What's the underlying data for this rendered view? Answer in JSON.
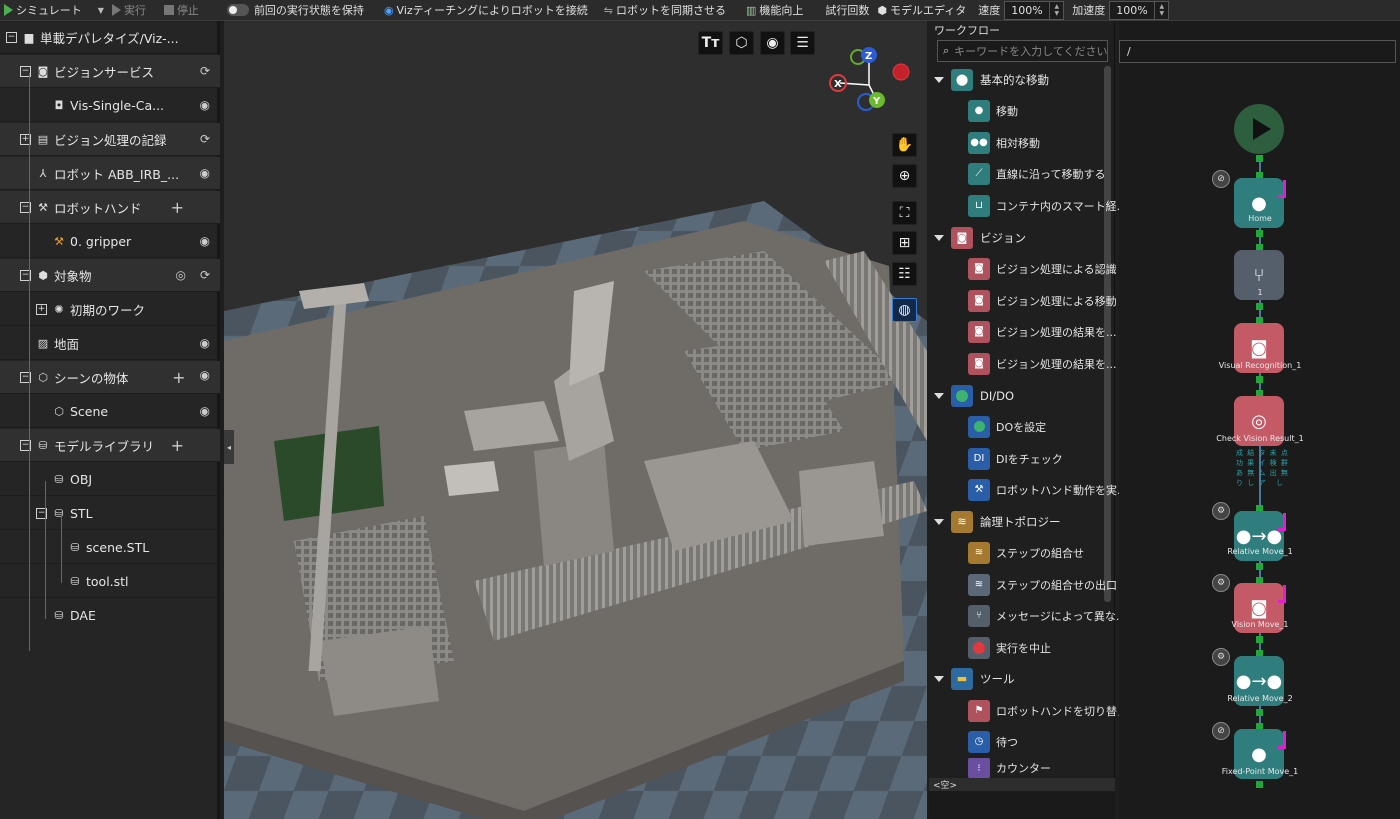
{
  "toolbar": {
    "simulate": "シミュレート",
    "run": "実行",
    "stop": "停止",
    "keep_state": "前回の実行状態を保持",
    "connect_robot": "Vizティーチングによりロボットを接続",
    "sync_robot": "ロボットを同期させる",
    "enhance": "機能向上",
    "trial_count": "試行回数",
    "model_editor": "モデルエディタ",
    "speed_label": "速度",
    "speed_value": "100%",
    "accel_label": "加速度",
    "accel_value": "100%"
  },
  "tree": {
    "project": "単載デパレタイズ/Viz-...",
    "vision_service": "ビジョンサービス",
    "vis_single": "Vis-Single-Ca...",
    "vision_records": "ビジョン処理の記録",
    "robot": "ロボット ABB_IRB_...",
    "robot_hand": "ロボットハンド",
    "gripper": "0. gripper",
    "objects": "対象物",
    "initial_work": "初期のワーク",
    "ground": "地面",
    "scene_objects": "シーンの物体",
    "scene": "Scene",
    "model_library": "モデルライブラリ",
    "obj": "OBJ",
    "stl": "STL",
    "scene_stl": "scene.STL",
    "tool_stl": "tool.stl",
    "dae": "DAE"
  },
  "axes": {
    "z": "Z",
    "x": "X",
    "y": "Y"
  },
  "library": {
    "title": "ワークフロー",
    "search_placeholder": "キーワードを入力してください",
    "cat_basic": "基本的な移動",
    "move": "移動",
    "relative_move": "相対移動",
    "linear_move": "直線に沿って移動する",
    "container_move": "コンテナ内のスマート経...",
    "cat_vision": "ビジョン",
    "vision_recog": "ビジョン処理による認識",
    "vision_move": "ビジョン処理による移動",
    "vision_result1": "ビジョン処理の結果を...",
    "vision_result2": "ビジョン処理の結果を...",
    "cat_dido": "DI/DO",
    "set_do": "DOを設定",
    "check_di": "DIをチェック",
    "hand_action": "ロボットハンド動作を実...",
    "cat_logic": "論理トポロジー",
    "step_combo": "ステップの組合せ",
    "step_combo_exit": "ステップの組合せの出口",
    "branch_msg": "メッセージによって異な...",
    "abort": "実行を中止",
    "cat_tools": "ツール",
    "switch_hand": "ロボットハンドを切り替え",
    "wait": "待つ",
    "counter": "カウンター",
    "empty": "<空>"
  },
  "workflow": {
    "path": "/",
    "home": "Home",
    "branch_num": "1",
    "visual_recog": "Visual Recognition_1",
    "check_result": "Check Vision Result_1",
    "port_labels": "成 結 タ 未 点\n功 果 イ 検 群\nあ 無 ム 出 無\nり し ア   し",
    "rel_move1": "Relative Move_1",
    "vision_move": "Vision Move_1",
    "rel_move2": "Relative Move_2",
    "fixed_move": "Fixed-Point Move_1"
  }
}
